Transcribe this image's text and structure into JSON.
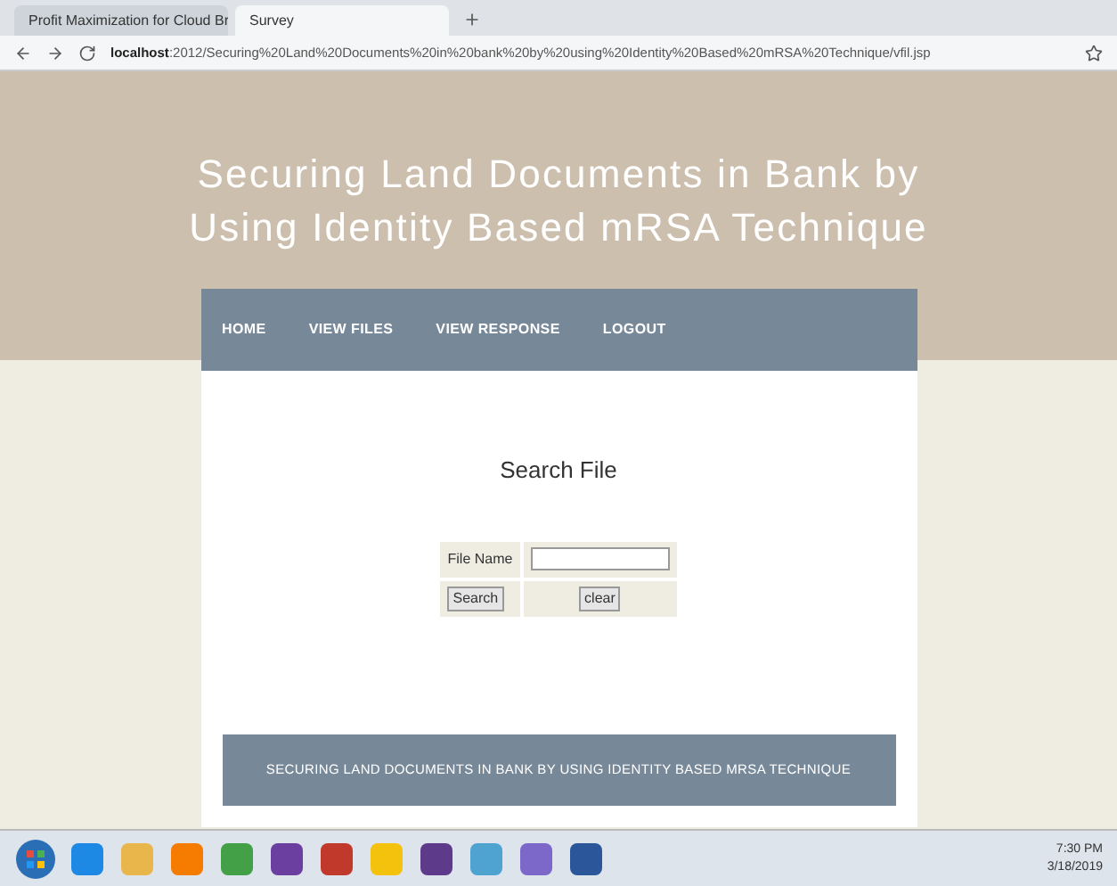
{
  "browser": {
    "tabs": [
      {
        "title": "Profit Maximization for Cloud Br",
        "selected": false
      },
      {
        "title": "Survey",
        "selected": true
      }
    ],
    "url_host": "localhost",
    "url_rest": ":2012/Securing%20Land%20Documents%20in%20bank%20by%20using%20Identity%20Based%20mRSA%20Technique/vfil.jsp"
  },
  "site_title": "Securing Land Documents in Bank by Using Identity Based mRSA Technique",
  "nav": [
    "HOME",
    "VIEW FILES",
    "VIEW RESPONSE",
    "LOGOUT"
  ],
  "search": {
    "heading": "Search File",
    "label": "File Name",
    "search_button": "Search",
    "clear_button": "clear"
  },
  "footer": "SECURING LAND DOCUMENTS IN BANK BY USING IDENTITY BASED MRSA TECHNIQUE",
  "taskbar": {
    "apps": [
      {
        "color": "#1e88e5"
      },
      {
        "color": "#e8b64a"
      },
      {
        "color": "#f57c00"
      },
      {
        "color": "#43a047"
      },
      {
        "color": "#6a3fa0"
      },
      {
        "color": "#c0392b"
      },
      {
        "color": "#f4c20d"
      },
      {
        "color": "#5d3a8a"
      },
      {
        "color": "#4fa3d1"
      },
      {
        "color": "#7b68c8"
      },
      {
        "color": "#2b579a"
      }
    ],
    "time": "7:30 PM",
    "date": "3/18/2019"
  }
}
